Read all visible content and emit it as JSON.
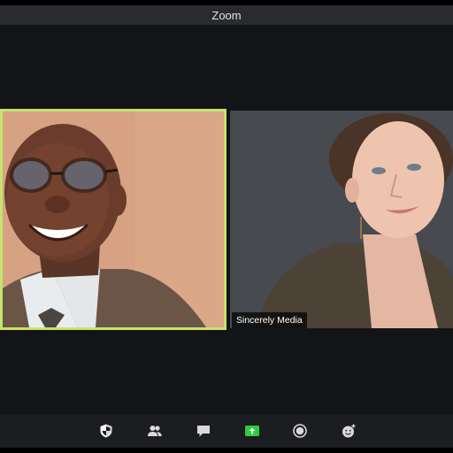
{
  "window": {
    "title": "Zoom"
  },
  "participants": [
    {
      "name": "",
      "active_speaker": true
    },
    {
      "name": "Sincerely Media",
      "active_speaker": false
    }
  ],
  "toolbar": {
    "buttons": [
      {
        "icon": "security-shield-icon"
      },
      {
        "icon": "participants-icon"
      },
      {
        "icon": "chat-icon"
      },
      {
        "icon": "share-screen-icon",
        "accent": "#2ecc40"
      },
      {
        "icon": "record-icon"
      },
      {
        "icon": "reactions-icon"
      }
    ]
  },
  "colors": {
    "active_speaker_border": "#c6e36a",
    "share_screen_green": "#2ecc40"
  }
}
